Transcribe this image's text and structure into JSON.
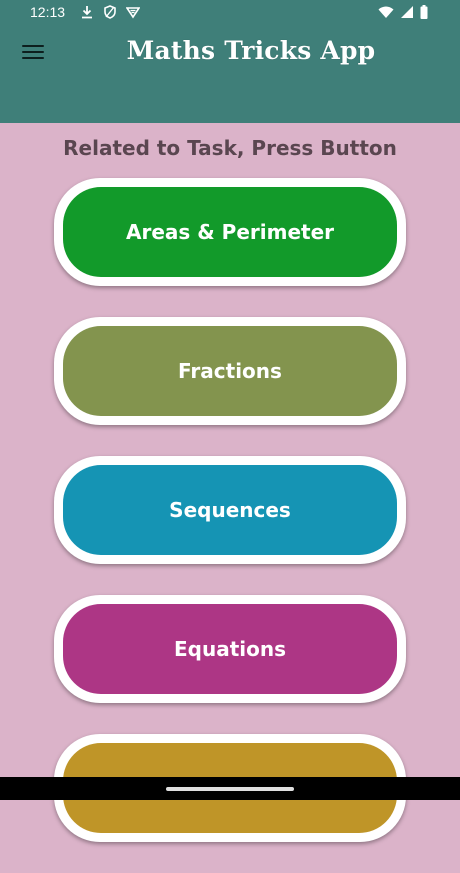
{
  "status_bar": {
    "time": "12:13",
    "icons": [
      "download-icon",
      "shield-icon",
      "vpn-icon",
      "wifi-icon",
      "signal-icon",
      "battery-icon"
    ]
  },
  "app_bar": {
    "title": "Maths Tricks App",
    "menu_icon": "hamburger-menu-icon"
  },
  "main": {
    "subtitle": "Related to Task, Press Button",
    "buttons": [
      {
        "label": "Areas & Perimeter",
        "color": "#129a2a"
      },
      {
        "label": "Fractions",
        "color": "#83944e"
      },
      {
        "label": "Sequences",
        "color": "#1594b4"
      },
      {
        "label": "Equations",
        "color": "#ad3685"
      },
      {
        "label": "",
        "color": "#bf9528"
      }
    ]
  },
  "colors": {
    "header": "#3f7f79",
    "background": "#dbb3c9",
    "subtitle_text": "#5a4650"
  }
}
